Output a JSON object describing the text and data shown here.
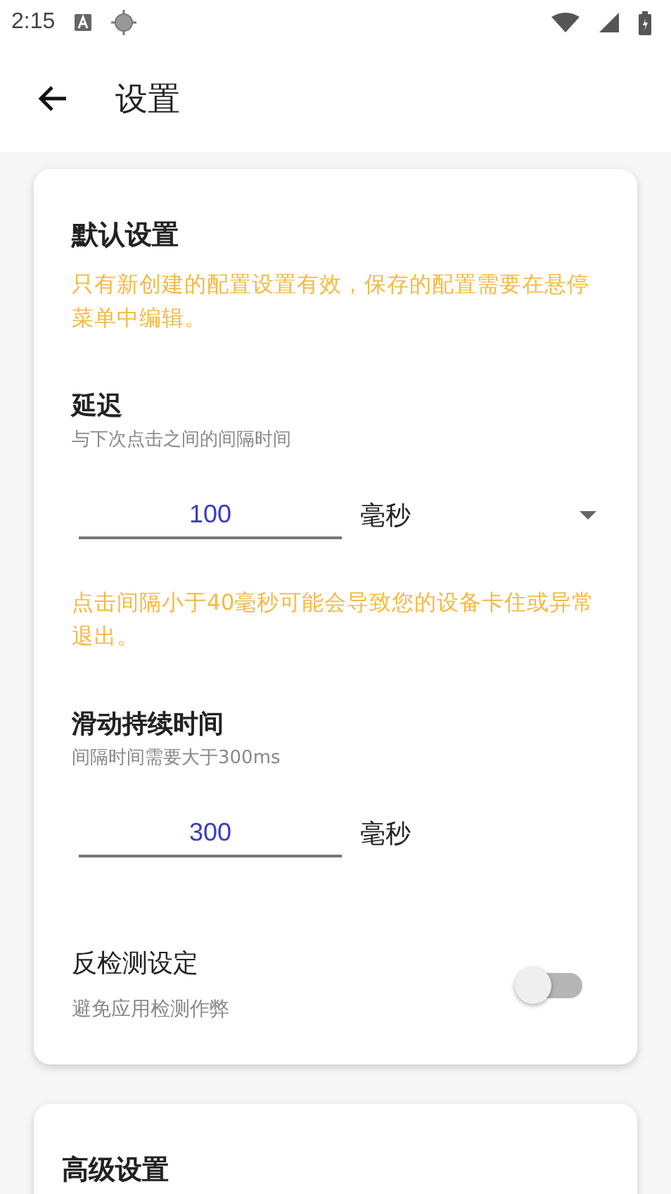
{
  "status_bar": {
    "time": "2:15"
  },
  "app_bar": {
    "title": "设置"
  },
  "cards": [
    {
      "title": "默认设置",
      "items": [
        {
          "kind": "note",
          "text": "只有新创建的配置设置有效，保存的配置需要在悬停菜单中编辑。"
        },
        {
          "kind": "number",
          "label": "延迟",
          "description": "与下次点击之间的间隔时间",
          "value": "100",
          "unit": "毫秒",
          "dropdown": true
        },
        {
          "kind": "note",
          "text": "点击间隔小于40毫秒可能会导致您的设备卡住或异常退出。"
        },
        {
          "kind": "number",
          "label": "滑动持续时间",
          "description": "间隔时间需要大于300ms",
          "value": "300",
          "unit": "毫秒",
          "dropdown": false
        },
        {
          "kind": "switch",
          "label": "反检测设定",
          "description": "避免应用检测作弊",
          "on": false
        }
      ]
    },
    {
      "title": "高级设置"
    }
  ]
}
